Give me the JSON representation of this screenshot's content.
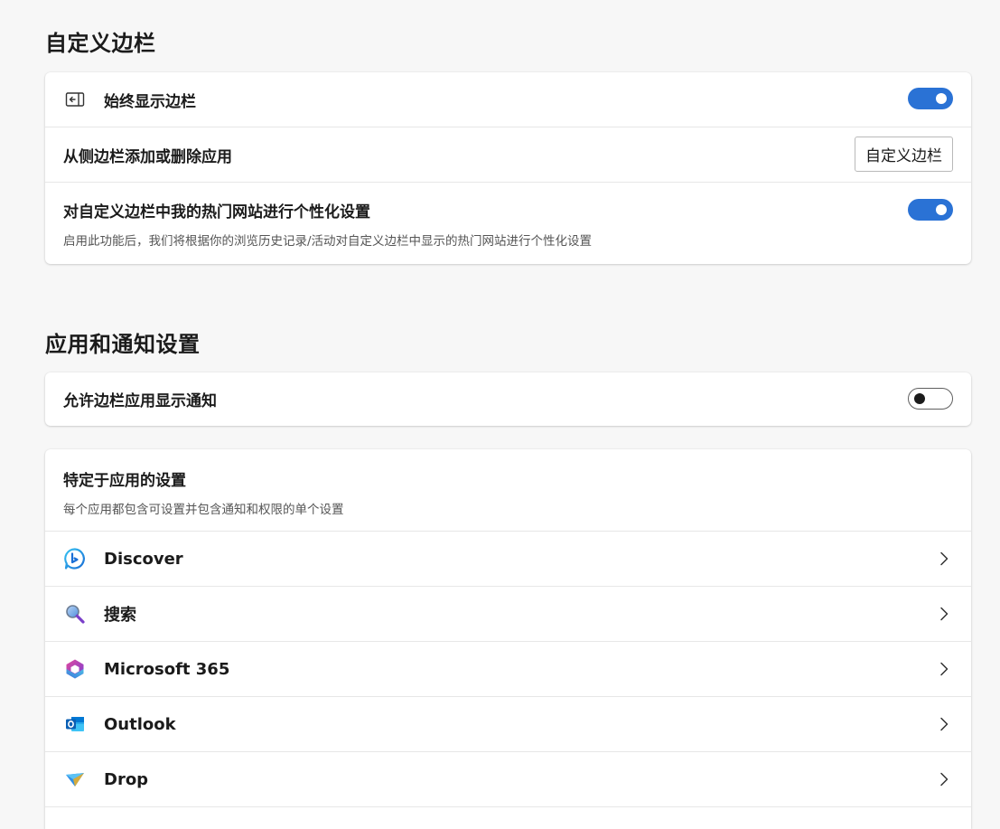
{
  "sidebar_section": {
    "title": "自定义边栏",
    "always_show": {
      "label": "始终显示边栏",
      "enabled": true
    },
    "add_remove": {
      "label": "从侧边栏添加或删除应用",
      "button_label": "自定义边栏"
    },
    "personalize": {
      "label": "对自定义边栏中我的热门网站进行个性化设置",
      "description": "启用此功能后，我们将根据你的浏览历史记录/活动对自定义边栏中显示的热门网站进行个性化设置",
      "enabled": true
    }
  },
  "apps_section": {
    "title": "应用和通知设置",
    "allow_notifications": {
      "label": "允许边栏应用显示通知",
      "enabled": false
    },
    "app_specific": {
      "title": "特定于应用的设置",
      "description": "每个应用都包含可设置并包含通知和权限的单个设置",
      "apps": [
        {
          "label": "Discover",
          "icon": "discover-icon"
        },
        {
          "label": "搜索",
          "icon": "search-icon"
        },
        {
          "label": "Microsoft 365",
          "icon": "microsoft-365-icon"
        },
        {
          "label": "Outlook",
          "icon": "outlook-icon"
        },
        {
          "label": "Drop",
          "icon": "drop-icon"
        }
      ]
    }
  },
  "colors": {
    "accent": "#2a72d5",
    "background": "#f7f7f7",
    "card": "#ffffff"
  }
}
